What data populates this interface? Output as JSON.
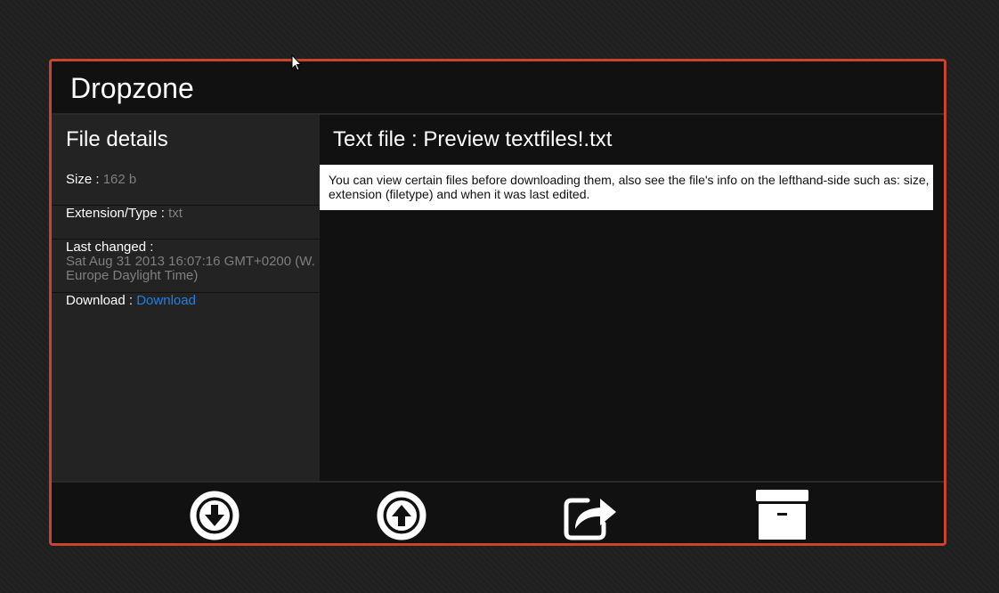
{
  "app": {
    "title": "Dropzone"
  },
  "sidebar": {
    "title": "File details",
    "size_label": "Size : ",
    "size_value": "162 b",
    "extension_label": "Extension/Type : ",
    "extension_value": "txt",
    "last_changed_label": "Last changed : ",
    "last_changed_value": "Sat Aug 31 2013 16:07:16 GMT+0200 (W. Europe Daylight Time)",
    "download_label": "Download : ",
    "download_link": "Download"
  },
  "preview": {
    "title": "Text file : Preview textfiles!.txt",
    "content": "You can view certain files before downloading them, also see the file's info on the lefthand-side such as: size, extension (filetype) and when it was last edited."
  },
  "toolbar": {
    "buttons": [
      {
        "icon": "download-icon"
      },
      {
        "icon": "upload-icon"
      },
      {
        "icon": "share-icon"
      },
      {
        "icon": "archive-icon"
      }
    ]
  },
  "colors": {
    "accent_border": "#c8442b",
    "link": "#1e7fe6",
    "sidebar_bg": "#232323",
    "panel_bg": "#111111"
  }
}
